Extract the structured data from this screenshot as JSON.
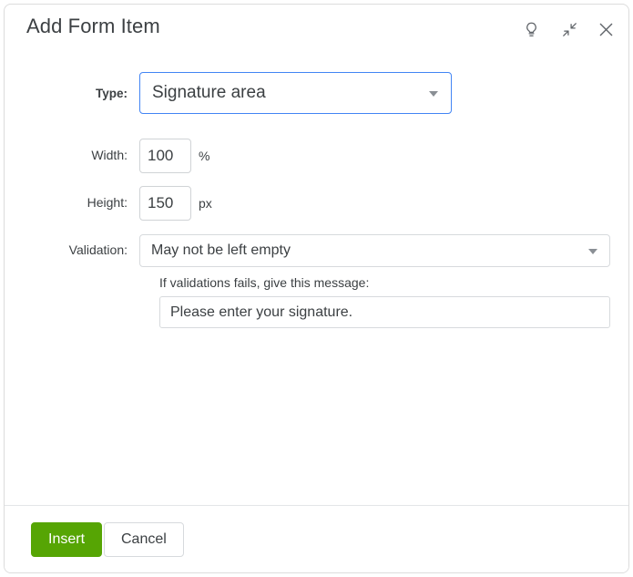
{
  "dialog": {
    "title": "Add Form Item",
    "icons": {
      "help": "lightbulb-icon",
      "collapse": "collapse-arrows-icon",
      "close": "close-icon"
    }
  },
  "form": {
    "type": {
      "label": "Type:",
      "value": "Signature area",
      "caret": "chevron-down-icon"
    },
    "width": {
      "label": "Width:",
      "value": "100",
      "unit": "%"
    },
    "height": {
      "label": "Height:",
      "value": "150",
      "unit": "px"
    },
    "validation": {
      "label": "Validation:",
      "value": "May not be left empty",
      "caret": "chevron-down-icon"
    },
    "message": {
      "hint": "If validations fails, give this message:",
      "value": "Please enter your signature."
    }
  },
  "footer": {
    "insert_label": "Insert",
    "cancel_label": "Cancel"
  },
  "colors": {
    "accent_green": "#56a504",
    "focus_blue": "#4285f4",
    "text": "#3c4043",
    "border": "#d7dadd"
  }
}
